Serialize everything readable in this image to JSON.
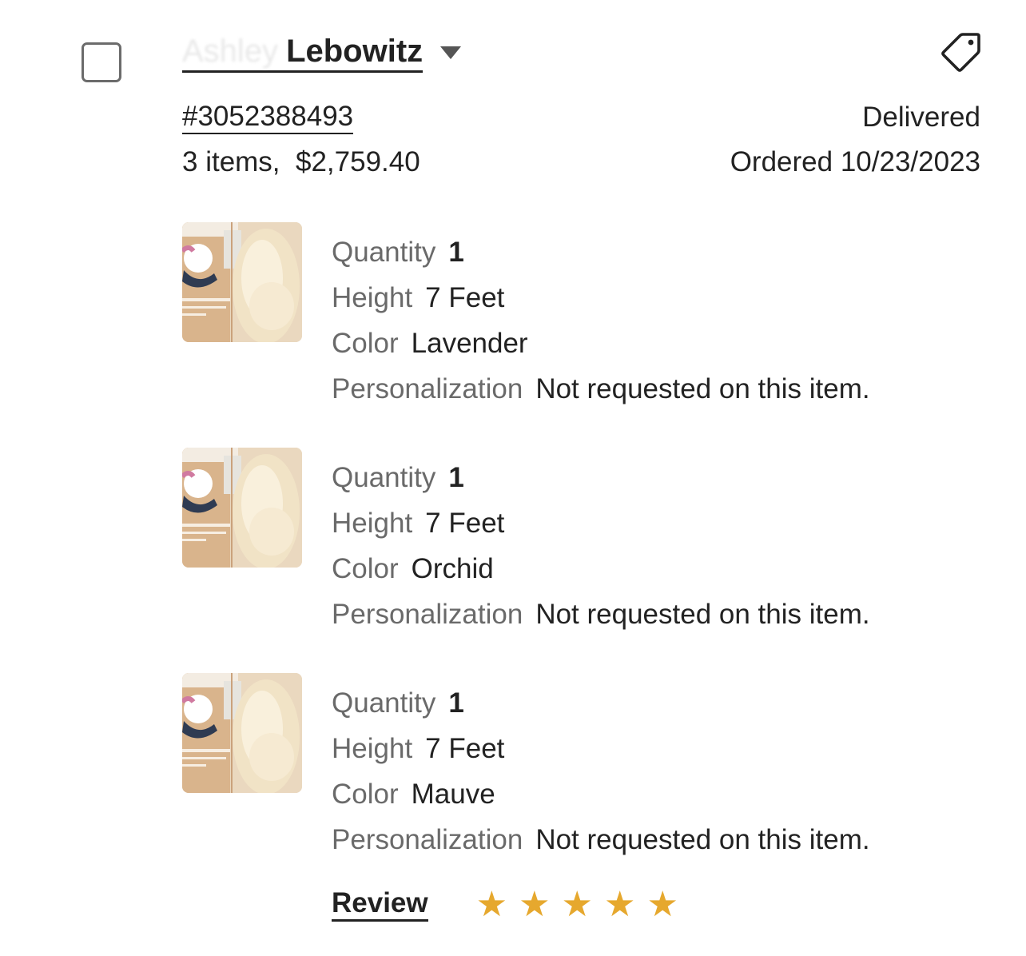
{
  "order": {
    "buyer_first_name": "Ashley",
    "buyer_last_name": "Lebowitz",
    "order_number": "#3052388493",
    "summary": "3 items,  $2,759.40",
    "status": "Delivered",
    "ordered_date": "Ordered 10/23/2023",
    "tag_icon": "tag-icon",
    "caret_icon": "chevron-down-icon"
  },
  "labels": {
    "quantity": "Quantity",
    "height": "Height",
    "color": "Color",
    "personalization": "Personalization"
  },
  "items": [
    {
      "quantity": "1",
      "height": "7 Feet",
      "color": "Lavender",
      "personalization": "Not requested on this item."
    },
    {
      "quantity": "1",
      "height": "7 Feet",
      "color": "Orchid",
      "personalization": "Not requested on this item."
    },
    {
      "quantity": "1",
      "height": "7 Feet",
      "color": "Mauve",
      "personalization": "Not requested on this item."
    }
  ],
  "review": {
    "link_label": "Review",
    "rating": 5,
    "max_rating": 5,
    "star_color": "#e6a82e"
  }
}
